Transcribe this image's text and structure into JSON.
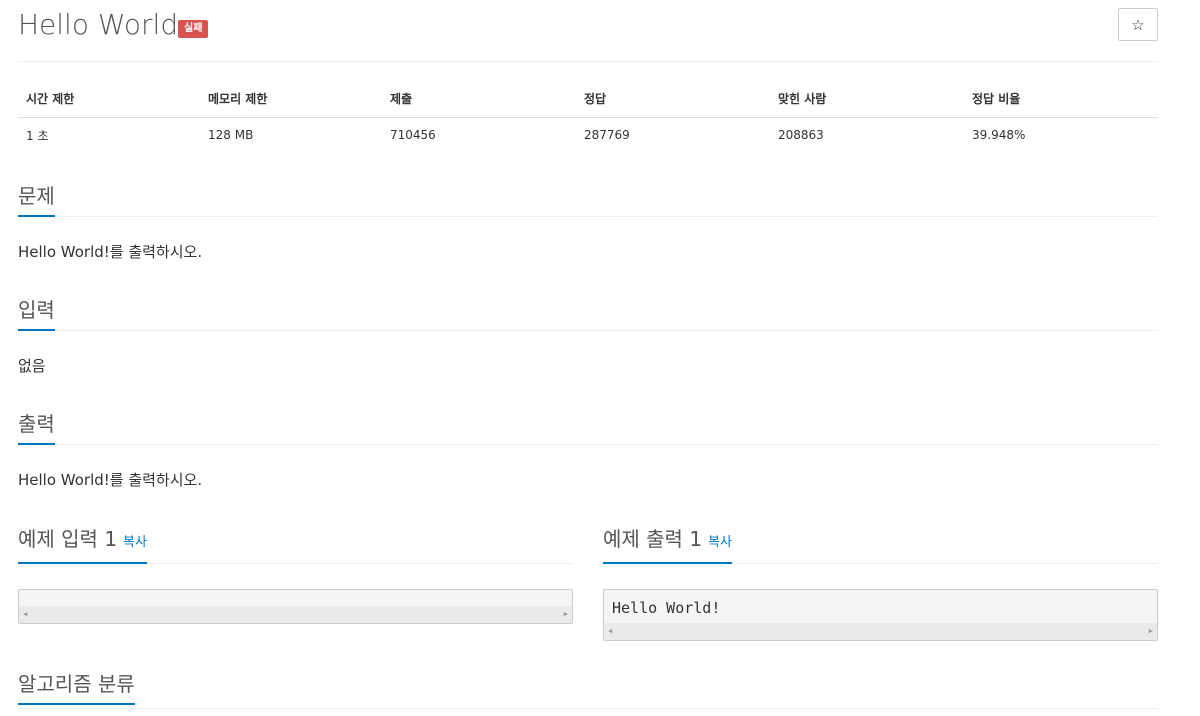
{
  "header": {
    "title": "Hello World",
    "badge": "실패",
    "star_icon": "☆"
  },
  "info_table": {
    "headers": [
      "시간 제한",
      "메모리 제한",
      "제출",
      "정답",
      "맞힌 사람",
      "정답 비율"
    ],
    "values": [
      "1 초",
      "128 MB",
      "710456",
      "287769",
      "208863",
      "39.948%"
    ]
  },
  "problem": {
    "title": "문제",
    "body": "Hello World!를 출력하시오."
  },
  "input": {
    "title": "입력",
    "body": "없음"
  },
  "output": {
    "title": "출력",
    "body": "Hello World!를 출력하시오."
  },
  "sample_input": {
    "title": "예제 입력 1",
    "copy_label": "복사",
    "content": ""
  },
  "sample_output": {
    "title": "예제 출력 1",
    "copy_label": "복사",
    "content": "Hello World!"
  },
  "algorithm": {
    "title": "알고리즘 분류"
  },
  "colors": {
    "accent": "#0076c0",
    "badge": "#d9534f"
  }
}
